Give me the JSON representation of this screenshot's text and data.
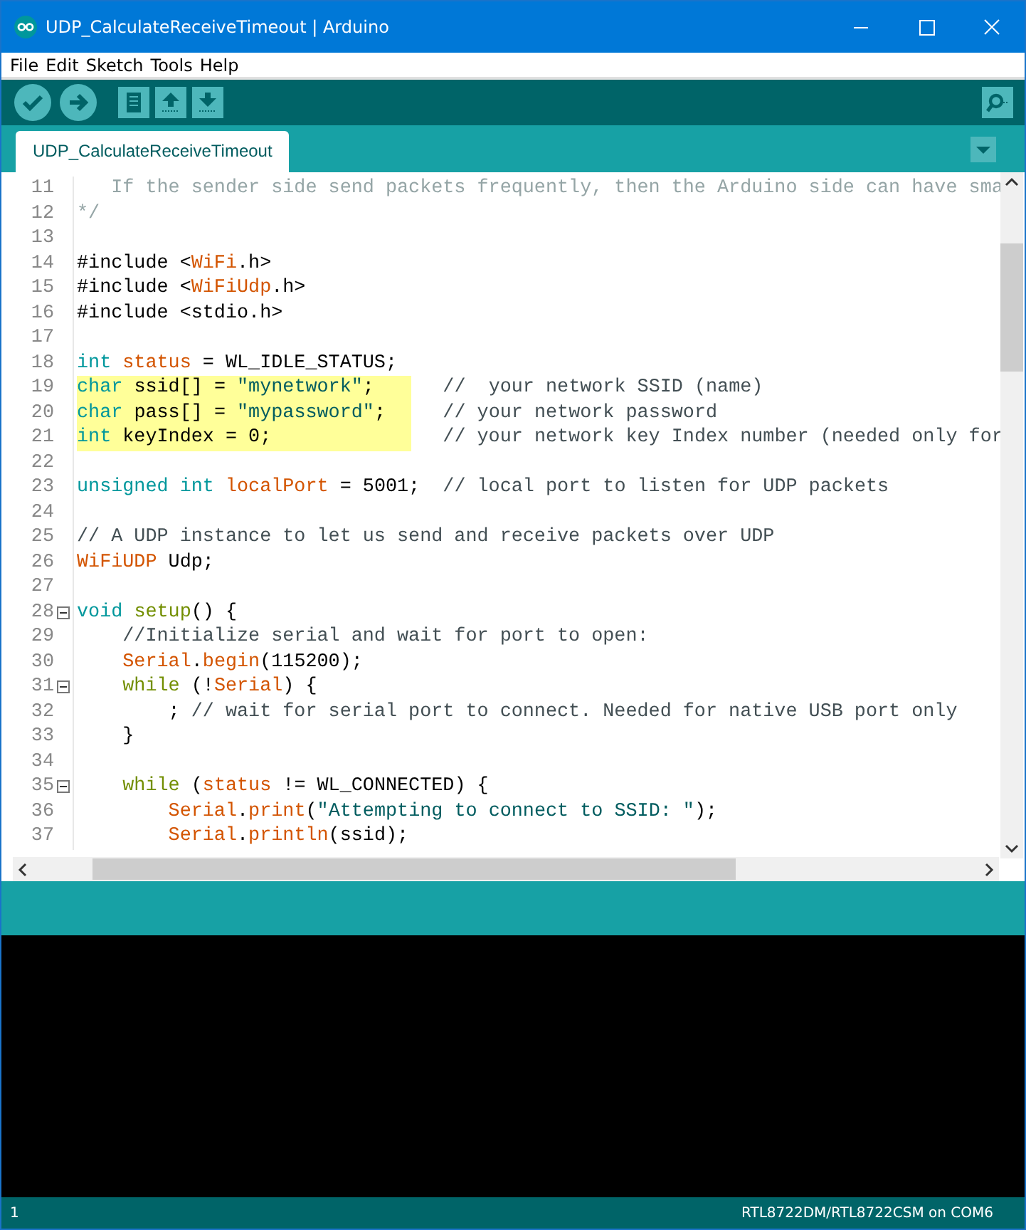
{
  "window": {
    "title": "UDP_CalculateReceiveTimeout | Arduino"
  },
  "menu": [
    "File",
    "Edit",
    "Sketch",
    "Tools",
    "Help"
  ],
  "tabs": [
    {
      "label": "UDP_CalculateReceiveTimeout",
      "selected": true
    }
  ],
  "lines": [
    {
      "number": "11",
      "fold": false,
      "selected": false,
      "tokens": [
        {
          "kind": "doc",
          "text": "   If the sender side send packets frequently, then the Arduino side can have sma"
        }
      ]
    },
    {
      "number": "12",
      "fold": false,
      "selected": false,
      "tokens": [
        {
          "kind": "doc",
          "text": "*/"
        }
      ]
    },
    {
      "number": "13",
      "fold": false,
      "selected": false
    },
    {
      "number": "14",
      "fold": false,
      "selected": false,
      "tokens": [
        {
          "kind": "plain",
          "text": "#include <"
        },
        {
          "kind": "ident",
          "text": "WiFi"
        },
        {
          "kind": "plain",
          "text": ".h>"
        }
      ]
    },
    {
      "number": "15",
      "fold": false,
      "selected": false,
      "tokens": [
        {
          "kind": "plain",
          "text": "#include <"
        },
        {
          "kind": "ident",
          "text": "WiFiUdp"
        },
        {
          "kind": "plain",
          "text": ".h>"
        }
      ]
    },
    {
      "number": "16",
      "fold": false,
      "selected": false,
      "tokens": [
        {
          "kind": "plain",
          "text": "#include <stdio.h>"
        }
      ]
    },
    {
      "number": "17",
      "fold": false,
      "selected": false
    },
    {
      "number": "18",
      "fold": false,
      "selected": false,
      "tokens": [
        {
          "kind": "type",
          "text": "int"
        },
        {
          "kind": "ident",
          "text": " status"
        },
        {
          "kind": "plain",
          "text": " = WL_IDLE_STATUS;"
        }
      ]
    },
    {
      "number": "19",
      "fold": false,
      "selected": true,
      "tokens": [
        {
          "kind": "type",
          "text": "char"
        },
        {
          "kind": "plain",
          "text": " ssid[] = "
        },
        {
          "kind": "string",
          "text": "\"mynetwork\""
        },
        {
          "kind": "plain",
          "text": ";      "
        },
        {
          "kind": "comment",
          "text": "//  your network SSID (name)"
        }
      ]
    },
    {
      "number": "20",
      "fold": false,
      "selected": true,
      "tokens": [
        {
          "kind": "type",
          "text": "char"
        },
        {
          "kind": "plain",
          "text": " pass[] = "
        },
        {
          "kind": "string",
          "text": "\"mypassword\""
        },
        {
          "kind": "plain",
          "text": ";     "
        },
        {
          "kind": "comment",
          "text": "// your network password"
        }
      ]
    },
    {
      "number": "21",
      "fold": false,
      "selected": true,
      "tokens": [
        {
          "kind": "type",
          "text": "int"
        },
        {
          "kind": "plain",
          "text": " keyIndex = 0;               "
        },
        {
          "kind": "comment",
          "text": "// your network key Index number (needed only for"
        }
      ]
    },
    {
      "number": "22",
      "fold": false,
      "selected": false
    },
    {
      "number": "23",
      "fold": false,
      "selected": false,
      "tokens": [
        {
          "kind": "type",
          "text": "unsigned int"
        },
        {
          "kind": "ident",
          "text": " localPort"
        },
        {
          "kind": "plain",
          "text": " = 5001;  "
        },
        {
          "kind": "comment",
          "text": "// local port to listen for UDP packets"
        }
      ]
    },
    {
      "number": "24",
      "fold": false,
      "selected": false
    },
    {
      "number": "25",
      "fold": false,
      "selected": false,
      "tokens": [
        {
          "kind": "comment",
          "text": "// A UDP instance to let us send and receive packets over UDP"
        }
      ]
    },
    {
      "number": "26",
      "fold": false,
      "selected": false,
      "tokens": [
        {
          "kind": "ident",
          "text": "WiFiUDP"
        },
        {
          "kind": "plain",
          "text": " Udp;"
        }
      ]
    },
    {
      "number": "27",
      "fold": false,
      "selected": false
    },
    {
      "number": "28",
      "fold": true,
      "selected": false,
      "tokens": [
        {
          "kind": "type",
          "text": "void"
        },
        {
          "kind": "control",
          "text": " setup"
        },
        {
          "kind": "plain",
          "text": "() {"
        }
      ]
    },
    {
      "number": "29",
      "fold": false,
      "selected": false,
      "tokens": [
        {
          "kind": "comment",
          "text": "    //Initialize serial and wait for port to open:"
        }
      ]
    },
    {
      "number": "30",
      "fold": false,
      "selected": false,
      "tokens": [
        {
          "kind": "ident",
          "text": "    Serial"
        },
        {
          "kind": "plain",
          "text": "."
        },
        {
          "kind": "ident",
          "text": "begin"
        },
        {
          "kind": "plain",
          "text": "(115200);"
        }
      ]
    },
    {
      "number": "31",
      "fold": true,
      "selected": false,
      "tokens": [
        {
          "kind": "control",
          "text": "    while"
        },
        {
          "kind": "plain",
          "text": " (!"
        },
        {
          "kind": "ident",
          "text": "Serial"
        },
        {
          "kind": "plain",
          "text": ") {"
        }
      ]
    },
    {
      "number": "32",
      "fold": false,
      "selected": false,
      "tokens": [
        {
          "kind": "plain",
          "text": "        ; "
        },
        {
          "kind": "comment",
          "text": "// wait for serial port to connect. Needed for native USB port only"
        }
      ]
    },
    {
      "number": "33",
      "fold": false,
      "selected": false,
      "tokens": [
        {
          "kind": "plain",
          "text": "    }"
        }
      ]
    },
    {
      "number": "34",
      "fold": false,
      "selected": false
    },
    {
      "number": "35",
      "fold": true,
      "selected": false,
      "tokens": [
        {
          "kind": "control",
          "text": "    while"
        },
        {
          "kind": "plain",
          "text": " ("
        },
        {
          "kind": "ident",
          "text": "status"
        },
        {
          "kind": "plain",
          "text": " != WL_CONNECTED) {"
        }
      ]
    },
    {
      "number": "36",
      "fold": false,
      "selected": false,
      "tokens": [
        {
          "kind": "ident",
          "text": "        Serial"
        },
        {
          "kind": "plain",
          "text": "."
        },
        {
          "kind": "ident",
          "text": "print"
        },
        {
          "kind": "plain",
          "text": "("
        },
        {
          "kind": "string",
          "text": "\"Attempting to connect to SSID: \""
        },
        {
          "kind": "plain",
          "text": ");"
        }
      ]
    },
    {
      "number": "37",
      "fold": false,
      "selected": false,
      "tokens": [
        {
          "kind": "ident",
          "text": "        Serial"
        },
        {
          "kind": "plain",
          "text": "."
        },
        {
          "kind": "ident",
          "text": "println"
        },
        {
          "kind": "plain",
          "text": "(ssid);"
        }
      ]
    }
  ],
  "status_bar": {
    "line": "1",
    "board": "RTL8722DM/RTL8722CSM on COM6"
  }
}
